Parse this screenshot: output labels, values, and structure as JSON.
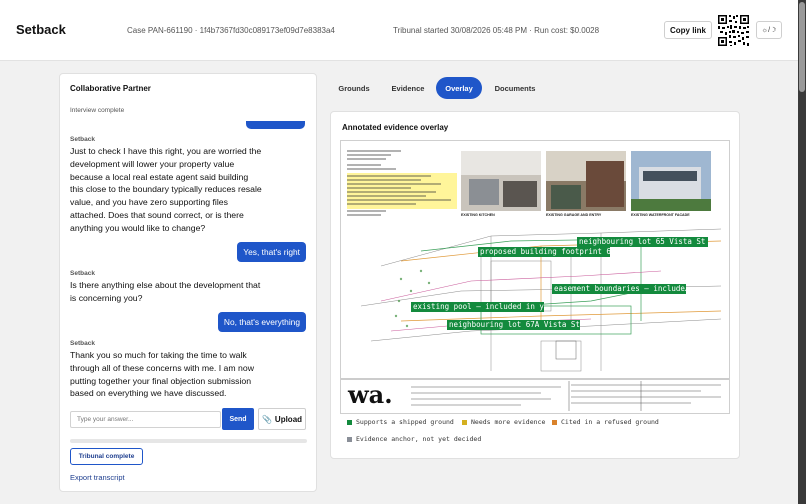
{
  "header": {
    "brand": "Setback",
    "case_info": "Case PAN-661190 · 1f4b7367fd30c089173ef09d7e8383a4",
    "session_info": "Tribunal started 30/08/2026 05:48 PM · Run cost: $0.0028",
    "copy_link_label": "Copy link",
    "theme_toggle_label": "☼/☽"
  },
  "chat_panel": {
    "title": "Collaborative Partner",
    "status": "Interview complete",
    "messages": [
      {
        "sender": "Setback",
        "text": "Just to check I have this right, you are worried the development will lower your property value because a local real estate agent said building this close to the boundary typically reduces resale value, and you have zero supporting files attached. Does that sound correct, or is there anything you would like to change?"
      },
      {
        "sender": "user",
        "text": "Yes, that's right"
      },
      {
        "sender": "Setback",
        "text": "Is there anything else about the development that is concerning you?"
      },
      {
        "sender": "user",
        "text": "No, that's everything"
      },
      {
        "sender": "Setback",
        "text": "Thank you so much for taking the time to walk through all of these concerns with me. I am now putting together your final objection submission based on everything we have discussed."
      }
    ],
    "input_placeholder": "Type your answer...",
    "send_label": "Send",
    "upload_label": "Upload",
    "upload_icon": "paperclip-icon",
    "progress_percent": 0,
    "tribunal_status_label": "Tribunal complete",
    "export_label": "Export transcript"
  },
  "tabs": [
    {
      "label": "Grounds",
      "active": false
    },
    {
      "label": "Evidence",
      "active": false
    },
    {
      "label": "Overlay",
      "active": true
    },
    {
      "label": "Documents",
      "active": false
    }
  ],
  "overlay_panel": {
    "title": "Annotated evidence overlay",
    "photo_captions": [
      "EXISTING KITCHEN",
      "EXISTING GARAGE AND ENTRY",
      "EXISTING WATERFRONT FACADE"
    ],
    "logo_text": "wa.",
    "annotations": [
      "neighbouring lot 65 Vista St — i…",
      "proposed building footprint 65A…",
      "easement boundaries — include…",
      "existing pool — included in your…",
      "neighbouring lot 67A Vista St —…"
    ],
    "legend": [
      {
        "label": "Supports a shipped ground",
        "color": "#138a3d"
      },
      {
        "label": "Needs more evidence",
        "color": "#d4b020"
      },
      {
        "label": "Cited in a refused ground",
        "color": "#d9822b"
      },
      {
        "label": "Evidence anchor, not yet decided",
        "color": "#8a8f98"
      }
    ]
  },
  "colors": {
    "accent": "#1f56c9",
    "annotation_green": "#138a3d"
  }
}
